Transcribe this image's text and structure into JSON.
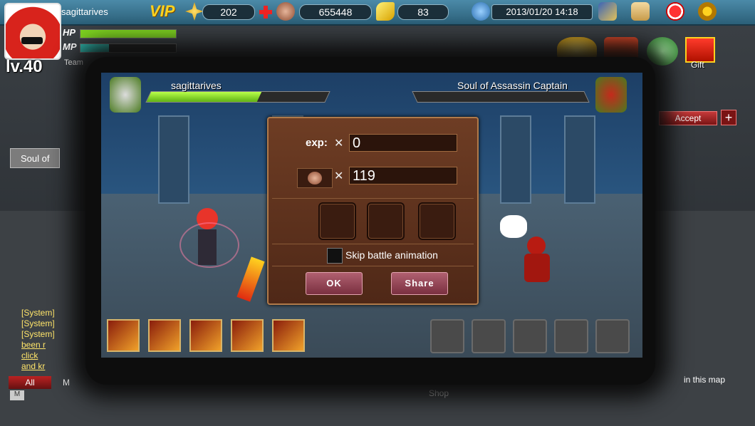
{
  "player": {
    "name": "sagittarives",
    "vip_label": "VIP",
    "level": "lv.40",
    "hp_label": "HP",
    "mp_label": "MP",
    "team_label": "Team"
  },
  "resources": {
    "stars": "202",
    "coins": "655448",
    "gold": "83"
  },
  "datetime": "2013/01/20 14:18",
  "side_buttons": {
    "gift_label": "Gift",
    "accept_label": "Accept",
    "soul_partial": "Soul of"
  },
  "battle": {
    "player_name": "sagittarives",
    "enemy_name": "Soul of Assassin Captain",
    "player_hp_fraction": 0.62,
    "enemy_hp_fraction": 0.0
  },
  "reward_dialog": {
    "exp_label": "exp:",
    "multiplier": "✕",
    "exp_value": "0",
    "coin_value": "119",
    "skip_label": "Skip battle animation",
    "ok_label": "OK",
    "share_label": "Share"
  },
  "chat": {
    "lines": [
      "[System]",
      "[System]",
      "[System]",
      "been r",
      "click",
      "and kr"
    ],
    "tab_all": "All",
    "tab_m": "M",
    "map_text": "in this map",
    "shop_label": "Shop"
  },
  "colors": {
    "hp_green": "#7ed320",
    "mp_teal": "#2bb3a8",
    "dialog_brown": "#5c301c",
    "button_pink": "#9a4455"
  }
}
